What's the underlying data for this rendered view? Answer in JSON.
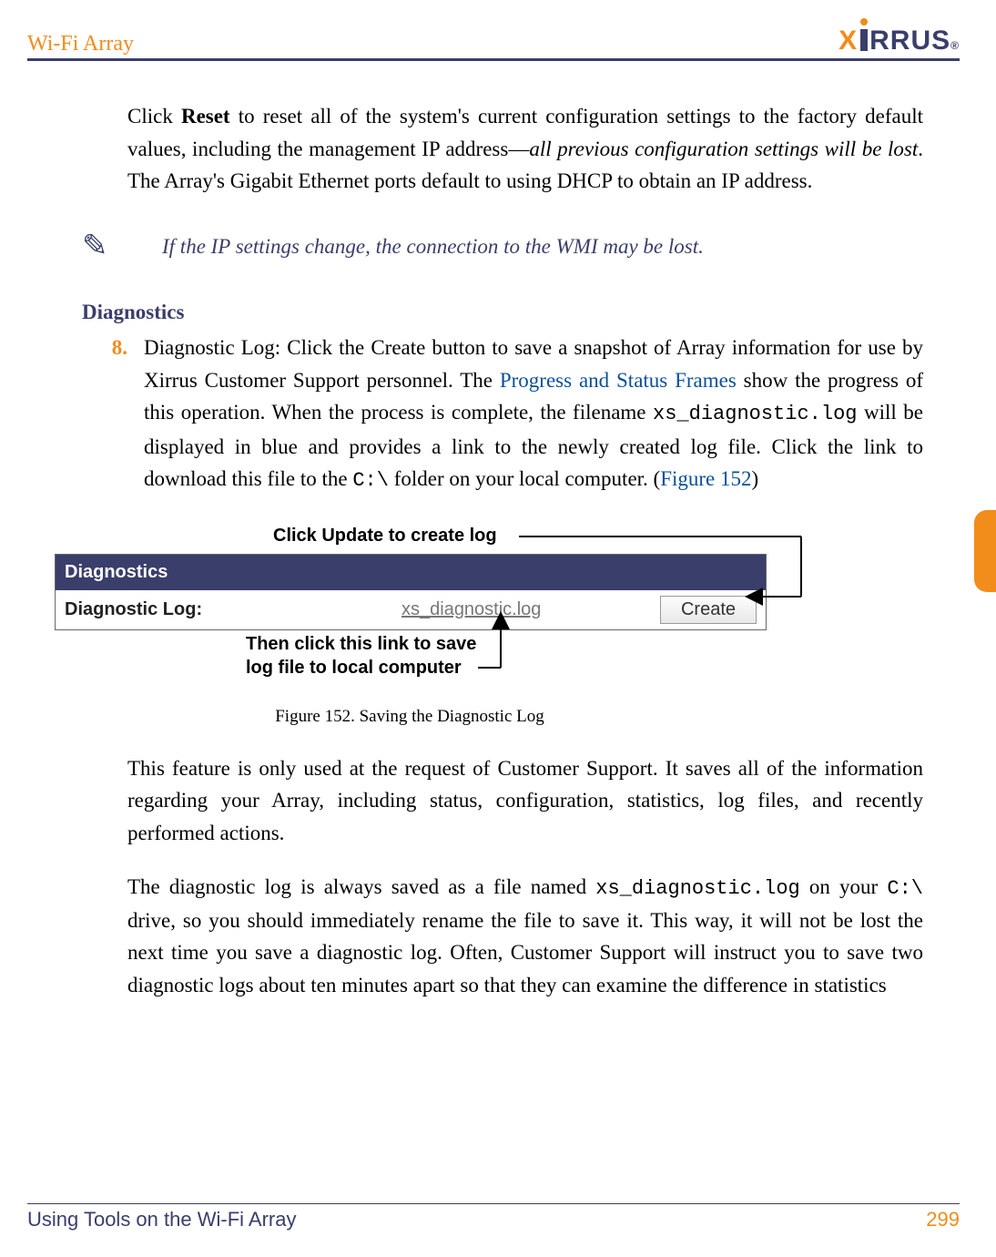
{
  "header": {
    "title": "Wi-Fi Array",
    "logo_x": "X",
    "logo_rest": "RRUS",
    "logo_reg": "®"
  },
  "intro": {
    "pre": "Click ",
    "bold": "Reset",
    "mid": " to reset all of the system's current configuration settings to the factory default values, including the management IP address—",
    "ital": "all previous configuration settings will be lost",
    "post": ". The Array's Gigabit Ethernet ports default to using DHCP to obtain an IP address."
  },
  "note": {
    "icon": "✎",
    "text": "If the IP settings change, the connection to the WMI may be lost."
  },
  "section_h": "Diagnostics",
  "item8": {
    "num": "8.",
    "label_bold": "Diagnostic Log",
    "after_label": ": Click the ",
    "create_bold": "Create",
    "t1": " button to save a snapshot of Array information for use by Xirrus Customer Support personnel. The ",
    "link1": "Progress and Status Frames",
    "t2": " show the progress of this operation. When the process is complete, the filename ",
    "mono1": "xs_diagnostic.log",
    "t3": " will be displayed in blue and provides a link to the newly created log file. Click the link to download this file to the ",
    "mono2": "C:\\",
    "t4": " folder on your local computer. (",
    "link2": "Figure 152",
    "t5": ")"
  },
  "callout_top": "Click Update to create log",
  "callout_bot_l1": "Then click this link to save",
  "callout_bot_l2": "log file to local computer",
  "diag": {
    "header": "Diagnostics",
    "label": "Diagnostic Log:",
    "file": "xs_diagnostic.log",
    "button": "Create"
  },
  "fig_caption": "Figure 152. Saving the Diagnostic Log",
  "para2": "This feature is only used at the request of Customer Support. It saves all of the information regarding your Array, including status, configuration, statistics, log files, and recently performed actions.",
  "para3": {
    "t1": "The diagnostic log is always saved as a file named ",
    "mono1": "xs_diagnostic.log",
    "t2": " on your ",
    "mono2": "C:\\",
    "t3": " drive, so you should immediately rename the file to save it. This way, it will not be lost the next time you save a diagnostic log. Often, Customer Support will instruct you to save two diagnostic logs about ten minutes apart so that they can examine the difference in statistics"
  },
  "footer": {
    "left": "Using Tools on the Wi-Fi Array",
    "right": "299"
  }
}
